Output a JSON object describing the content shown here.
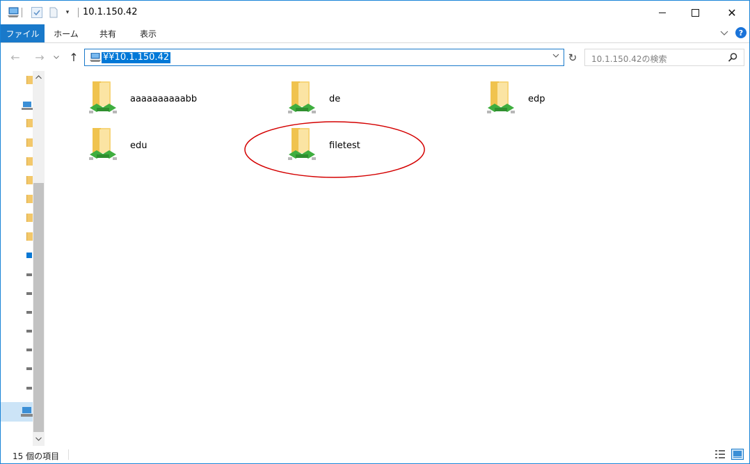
{
  "titlebar": {
    "title": "10.1.150.42",
    "icons": [
      "computer-icon",
      "properties-check-icon",
      "new-folder-icon",
      "customize-dropdown-icon"
    ],
    "min_symbol": "",
    "max_symbol": "",
    "close_symbol": "✕"
  },
  "ribbon": {
    "tabs": [
      {
        "label": "ファイル",
        "active": true
      },
      {
        "label": "ホーム"
      },
      {
        "label": "共有"
      },
      {
        "label": "表示"
      }
    ],
    "help_label": "?",
    "accent_color": "#1979ca"
  },
  "navbar": {
    "back_symbol": "←",
    "forward_symbol": "→",
    "up_symbol": "↑",
    "address_value": "¥¥10.1.150.42",
    "refresh_symbol": "↻",
    "search_placeholder": "10.1.150.42の検索"
  },
  "items": [
    {
      "name": "aaaaaaaaaabb"
    },
    {
      "name": "de"
    },
    {
      "name": "edp"
    },
    {
      "name": "edu"
    },
    {
      "name": "filetest",
      "highlighted": true
    }
  ],
  "annotation": {
    "shape": "ellipse",
    "color": "#d40000",
    "target": "filetest"
  },
  "status": {
    "item_count": "15 個の項目"
  }
}
